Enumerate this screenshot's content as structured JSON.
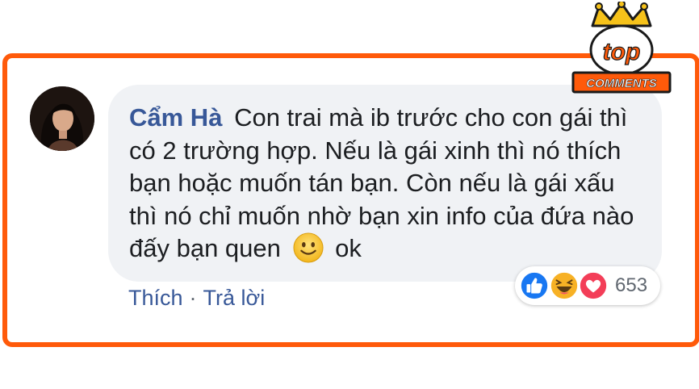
{
  "comment": {
    "author": "Cẩm Hà",
    "text": "Con trai mà ib trước cho con gái thì có 2 trường hợp. Nếu là gái xinh thì nó thích bạn hoặc muốn tán bạn. Còn nếu là gái xấu thì nó chỉ muốn nhờ bạn xin info của đứa nào đấy bạn quen",
    "emoji": "slightly-smiling-face",
    "trailing_text": "ok"
  },
  "actions": {
    "like_label": "Thích",
    "separator": "·",
    "reply_label": "Trả lời"
  },
  "reactions": {
    "types": [
      "like-icon",
      "haha-icon",
      "love-icon"
    ],
    "count": "653"
  },
  "badge": {
    "line1": "top",
    "line2": "COMMENTS"
  },
  "colors": {
    "frame": "#ff5a0a",
    "author": "#385898",
    "bubble": "#f0f2f5",
    "like": "#1877f2",
    "love": "#f33e58",
    "haha": "#f7b125"
  }
}
